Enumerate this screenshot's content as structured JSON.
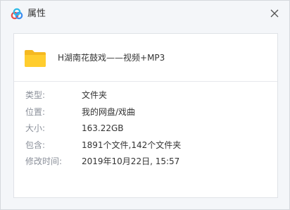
{
  "window": {
    "title": "属性",
    "app_icon": "baidu-netdisk-cloud-icon",
    "close_icon": "close-icon"
  },
  "file": {
    "icon": "folder-icon",
    "icon_color": "#f7c325",
    "name": "H湖南花鼓戏——视频+MP3"
  },
  "properties": [
    {
      "label": "类型:",
      "value": "文件夹"
    },
    {
      "label": "位置:",
      "value": "我的网盘/戏曲"
    },
    {
      "label": "大小:",
      "value": "163.22GB"
    },
    {
      "label": "包含:",
      "value": "1891个文件,142个文件夹"
    },
    {
      "label": "修改时间:",
      "value": "2019年10月22日, 15:57"
    }
  ],
  "colors": {
    "background": "#f4f6f9",
    "panel": "#ffffff",
    "label": "#8a8f99",
    "value": "#333333",
    "accent_blue": "#3b8cf0"
  }
}
